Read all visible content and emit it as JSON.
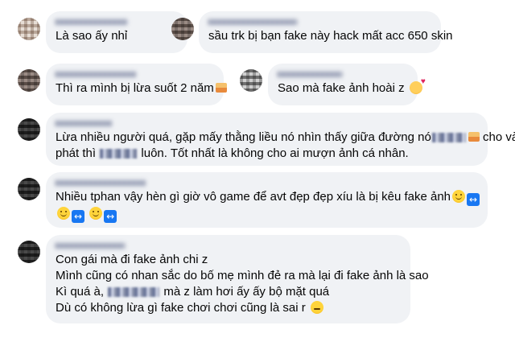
{
  "comments": [
    {
      "lines": [
        "Là sao ấy nhỉ"
      ]
    },
    {
      "lines": [
        "sầu trk bị bạn fake này hack mất acc 650 skin"
      ]
    },
    {
      "lines": [
        "Thì ra mình bị lừa suốt 2 năm"
      ]
    },
    {
      "lines": [
        "Sao mà fake ảnh hoài z"
      ]
    },
    {
      "line1_a": "Lừa nhiều người quá, gặp mấy thằng liều nó nhìn thấy giữa đường nó",
      "line1_b": "cho vài",
      "line2_a": "phát thì",
      "line2_b": "luôn. Tốt nhất là không cho ai mượn ảnh cá nhân."
    },
    {
      "lines": [
        "Nhiều tphan vậy hèn gì giờ vô game để avt đẹp đẹp xíu là bị kêu fake ảnh"
      ]
    },
    {
      "lines": [
        "Con gái mà đi fake ảnh chi z",
        "Mình cũng có nhan sắc do bố mẹ mình đẻ ra mà lại đi fake ảnh là sao"
      ],
      "line3_a": "Kì quá à,",
      "line3_b": "mà z làm hơi ấy ấy bộ mặt quá",
      "line4": "Dù có không lừa gì fake chơi chơi cũng là sai r"
    }
  ],
  "icons": {
    "smile": "slightly-smiling-face-icon",
    "heart": "smiling-face-with-hearts-icon",
    "sweat": "pensive-face-icon",
    "arrows": "left-right-arrow-icon"
  },
  "colors": {
    "bubble": "#f0f2f5",
    "text": "#050505",
    "arrow_box": "#1877f2"
  }
}
